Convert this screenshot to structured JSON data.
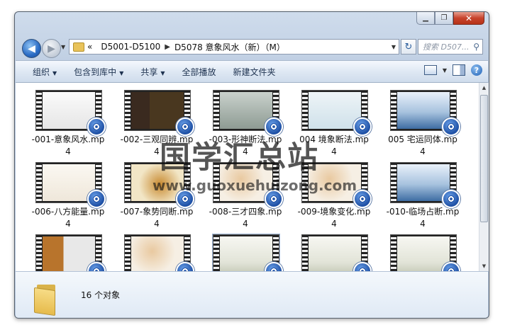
{
  "window": {
    "caption": {
      "minimize": "▁",
      "maximize": "❐",
      "close": "✕"
    }
  },
  "nav": {
    "back_icon": "back-arrow-icon",
    "forward_icon": "forward-arrow-icon",
    "back_glyph": "◀",
    "forward_glyph": "▶"
  },
  "address": {
    "overflow": "«",
    "crumbs": [
      "D5001-D5100",
      "D5078 意象风水（新）（M）"
    ],
    "separator": "▶"
  },
  "search": {
    "placeholder": "搜索 D507..."
  },
  "toolbar": {
    "organize": "组织",
    "include_library": "包含到库中",
    "share": "共享",
    "play_all": "全部播放",
    "new_folder": "新建文件夹"
  },
  "files": [
    {
      "name": "-001-意象风水.mp4",
      "thumb": "white"
    },
    {
      "name": "-002-三观同辨.mp4",
      "thumb": "slides"
    },
    {
      "name": "-003-形神断法.mp4",
      "thumb": "house"
    },
    {
      "name": "004 境象断法.mp4",
      "thumb": "calligraphy"
    },
    {
      "name": "005  宅运同体.mp4",
      "thumb": "blue-sky"
    },
    {
      "name": "-006-八方能量.mp4",
      "thumb": "seal"
    },
    {
      "name": "-007-象势同断.mp4",
      "thumb": "horse"
    },
    {
      "name": "-008-三才四象.mp4",
      "thumb": "flowers"
    },
    {
      "name": "-009-境象变化.mp4",
      "thumb": "flowers"
    },
    {
      "name": "-010-临场占断.mp4",
      "thumb": "blue-sky"
    },
    {
      "name": "",
      "thumb": "tiger"
    },
    {
      "name": "",
      "thumb": "flowers"
    },
    {
      "name": "",
      "thumb": "mist"
    },
    {
      "name": "",
      "thumb": "mist"
    },
    {
      "name": "",
      "thumb": "mist"
    }
  ],
  "watermark": {
    "chinese": "国学汇总站",
    "url": "www.guoxuehuizong.com"
  },
  "details": {
    "count": "16 个对象"
  }
}
